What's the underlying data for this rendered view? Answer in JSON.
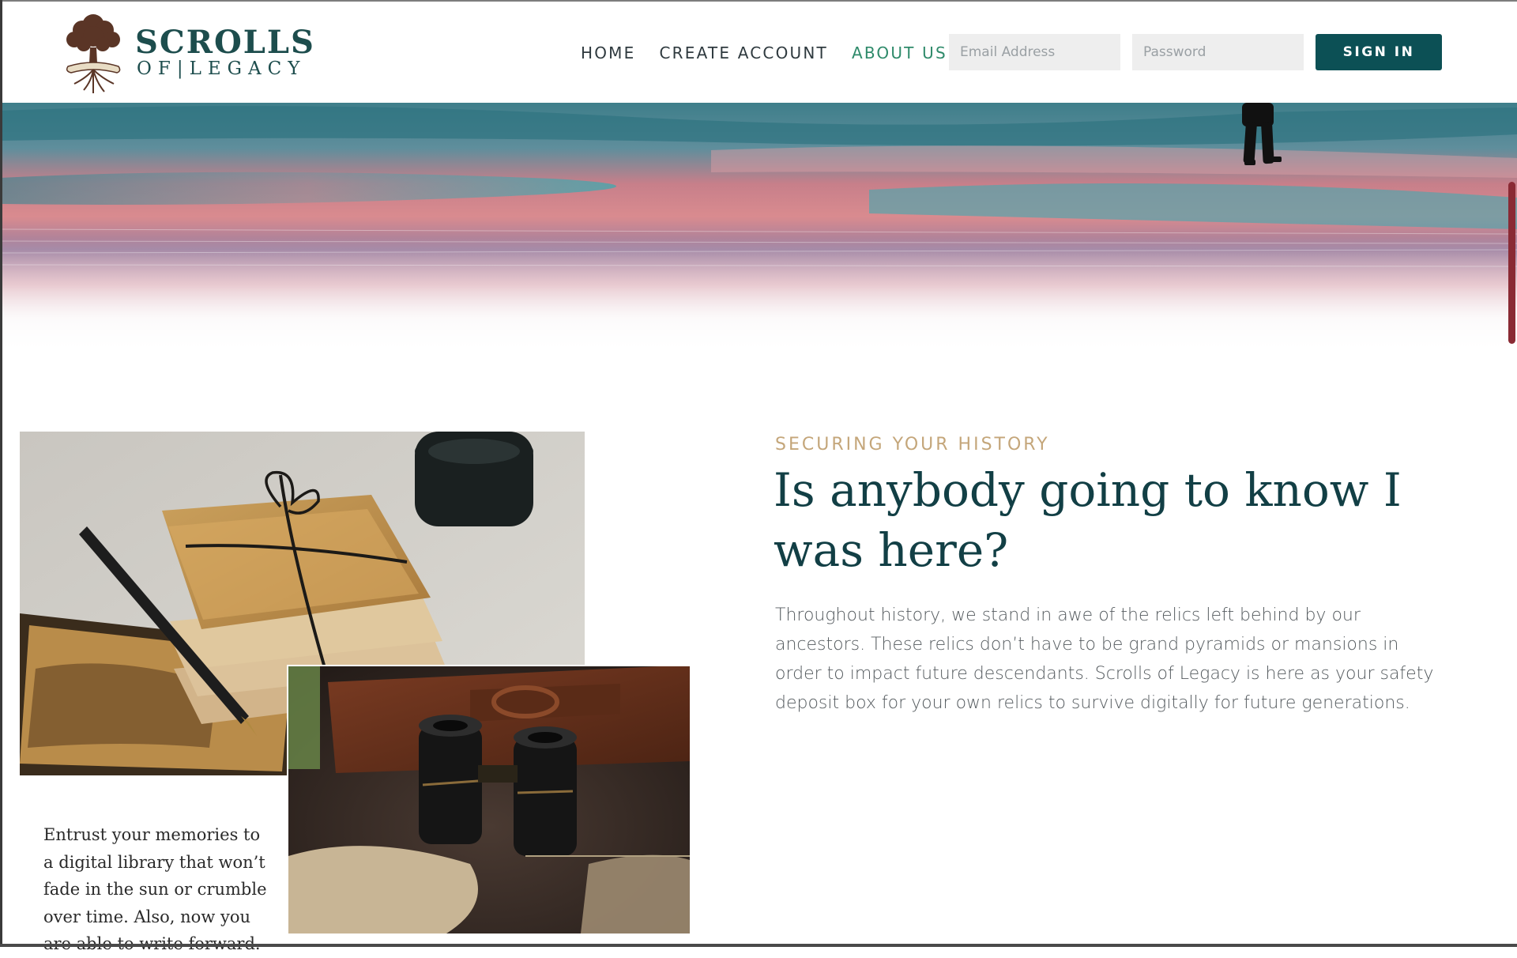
{
  "brand": {
    "name_line1": "SCROLLS",
    "name_line2": "OF|LEGACY",
    "colors": {
      "primary": "#1d4d4d",
      "tree": "#5a3526",
      "accent": "#2e8a6a",
      "gold": "#c4a67a",
      "button": "#0c5055"
    }
  },
  "nav": {
    "items": [
      {
        "label": "HOME",
        "active": false
      },
      {
        "label": "CREATE ACCOUNT",
        "active": false
      },
      {
        "label": "ABOUT US",
        "active": true
      }
    ]
  },
  "login": {
    "email_placeholder": "Email Address",
    "email_value": "",
    "password_placeholder": "Password",
    "password_value": "",
    "signin_label": "SIGN IN"
  },
  "hero": {
    "image": "snowy-landscape-with-walking-person"
  },
  "images": {
    "letters": "bundle-of-letters-pen-and-inkwell",
    "binoculars": "vintage-binoculars-on-fur"
  },
  "caption": "Entrust your memories to a digital library that won’t fade in the sun or crumble over time. Also, now you are able to write forward.",
  "section": {
    "eyebrow": "SECURING YOUR HISTORY",
    "headline": "Is anybody going to know I was here?",
    "body": "Throughout history, we stand in awe of the relics left behind by our ancestors. These relics don’t have to be grand pyramids or mansions in order to impact future descendants. Scrolls of Legacy is here as your safety deposit box for your own relics to survive digitally for future generations."
  }
}
